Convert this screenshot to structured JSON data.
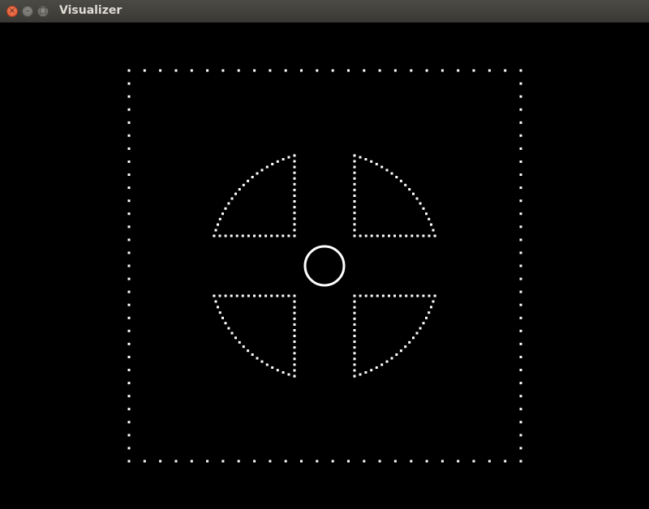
{
  "window": {
    "title": "Visualizer",
    "buttons": {
      "close_glyph": "×",
      "minimize_glyph": "–",
      "maximize_glyph": "□"
    }
  },
  "colors": {
    "background": "#000000",
    "foreground": "#ffffff",
    "titlebar": "#3f3e3a",
    "close": "#e35a33"
  },
  "scene": {
    "boundary": "dotted square",
    "quadrants": [
      "top-left",
      "top-right",
      "bottom-left",
      "bottom-right"
    ],
    "center_marker": "circle"
  }
}
